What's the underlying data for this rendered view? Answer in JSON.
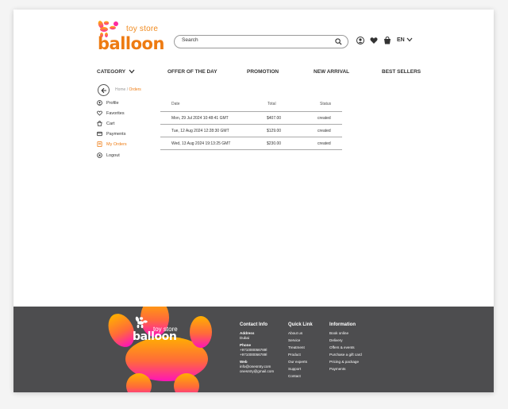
{
  "brand": {
    "top_text": "toy store",
    "main_text": "balloon"
  },
  "search": {
    "placeholder": "Search"
  },
  "header": {
    "language": "EN"
  },
  "nav": {
    "category": "CATEGORY",
    "offer": "OFFER OF THE DAY",
    "promotion": "PROMOTION",
    "new_arrival": "NEW ARRIVAL",
    "best_sellers": "BEST SELLERS"
  },
  "breadcrumb": {
    "home": "Home",
    "separator": "/",
    "current": "Orders"
  },
  "sidebar": {
    "items": [
      {
        "label": "Profile",
        "icon": "profile-icon"
      },
      {
        "label": "Favorites",
        "icon": "heart-icon"
      },
      {
        "label": "Cart",
        "icon": "cart-icon"
      },
      {
        "label": "Payments",
        "icon": "card-icon"
      },
      {
        "label": "My Orders",
        "icon": "orders-icon"
      },
      {
        "label": "Logout",
        "icon": "logout-icon"
      }
    ]
  },
  "orders": {
    "headers": {
      "date": "Date",
      "total": "Total",
      "status": "Status"
    },
    "rows": [
      {
        "date": "Mon, 29 Jul 2024 10:48:41 GMT",
        "total": "$407.00",
        "status": "created"
      },
      {
        "date": "Tue, 12 Aug 2024 12:28:30 GMT",
        "total": "$129.00",
        "status": "created"
      },
      {
        "date": "Wed, 13 Aug 2024 19:13:25 GMT",
        "total": "$230.00",
        "status": "created"
      }
    ]
  },
  "footer": {
    "contact": {
      "title": "Contact Info",
      "address_label": "Address",
      "address": "Dubai",
      "phone_label": "Phone",
      "phone1": "+971000056789l",
      "phone2": "+971000056789l",
      "web_label": "Web",
      "web1": "info@onesntry.com",
      "web2": "onesntry@gmail.com"
    },
    "quick": {
      "title": "Quick Link",
      "links": [
        "About us",
        "Service",
        "Treatment",
        "Product",
        "Our experts",
        "Support",
        "Contact"
      ]
    },
    "info": {
      "title": "Information",
      "links": [
        "Book online",
        "Delivery",
        "Offers & events",
        "Purchase a gift card",
        "Pricing & package",
        "Payments"
      ]
    }
  },
  "colors": {
    "accent": "#ee7b12",
    "footer_bg": "#4d4d4f"
  }
}
